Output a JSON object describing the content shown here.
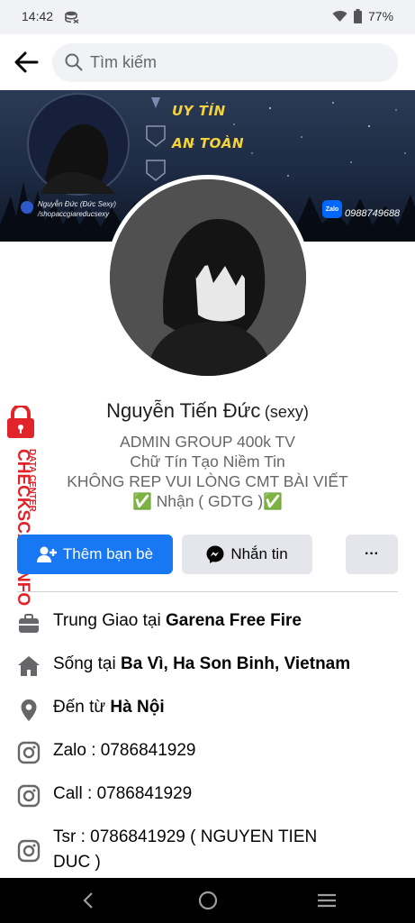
{
  "status_bar": {
    "time": "14:42",
    "battery": "77%"
  },
  "search": {
    "placeholder": "Tìm kiếm",
    "value": ""
  },
  "cover": {
    "slogans": [
      "UY TÍN",
      "AN TOÀN"
    ],
    "small_text_1": "Nguyễn Đức (Đức Sexy)",
    "small_text_2": "/shopaccgiareducsexy",
    "zalo_label": "Zalo",
    "phone": "0988749688"
  },
  "profile": {
    "name": "Nguyễn Tiến Đức",
    "alt_name": "(sexy)",
    "bio": [
      "ADMIN GROUP 400k TV",
      "Chữ Tín Tạo Niềm Tin",
      "KHÔNG REP VUI LÒNG CMT BÀI VIẾT",
      "✅ Nhận ( GDTG )✅"
    ]
  },
  "actions": {
    "add_friend": "Thêm bạn bè",
    "message": "Nhắn tin",
    "more": "···"
  },
  "watermark": {
    "data_center": "DATA CENTER",
    "brand": "CHECKSCAM.INFO"
  },
  "details": [
    {
      "icon": "briefcase-icon",
      "prefix": "Trung Giao tại ",
      "bold": "Garena Free Fire"
    },
    {
      "icon": "home-icon",
      "prefix": "Sống tại ",
      "bold": "Ba Vì, Ha Son Binh, Vietnam"
    },
    {
      "icon": "location-pin-icon",
      "prefix": "Đến từ ",
      "bold": "Hà Nội"
    },
    {
      "icon": "instagram-icon",
      "prefix": "Zalo : 0786841929",
      "bold": ""
    },
    {
      "icon": "instagram-icon",
      "prefix": "Call : 0786841929",
      "bold": ""
    },
    {
      "icon": "instagram-icon",
      "prefix": "Tsr : 0786841929 ( NGUYEN TIEN",
      "bold": ""
    },
    {
      "icon": "",
      "prefix": "DUC )",
      "bold": ""
    }
  ],
  "colors": {
    "primary": "#1877f2",
    "secondary_button": "#e4e6eb",
    "watermark_red": "#e0242a",
    "slogan_yellow": "#f5d33c"
  }
}
